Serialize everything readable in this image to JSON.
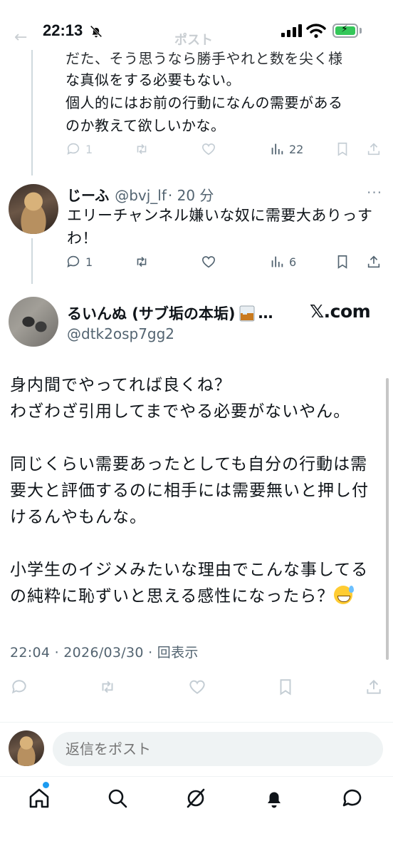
{
  "status_bar": {
    "time": "22:13"
  },
  "header": {
    "title": "ポスト"
  },
  "parent_tweet": {
    "lines": [
      "だた、そう思うなら勝手やれと数を尖く様",
      "な真似をする必要もない。",
      "個人的にはお前の行動になんの需要がある",
      "のか教えて欲しいかな。"
    ],
    "replies": "1",
    "views": "22"
  },
  "reply_tweet": {
    "name": "じーふ",
    "handle": "@bvj_lf",
    "time": "· 20 分",
    "text": "エリーチャンネル嫌いな奴に需要大ありっすわ！",
    "replies": "1",
    "views": "6"
  },
  "main_tweet": {
    "name": "るいんぬ (サブ垢の本垢)",
    "ellipsis": "…",
    "handle": "@dtk2osp7gg2",
    "watermark": "𝕏.com",
    "paragraphs": [
      "身内間でやってれば良くね？",
      "わざわざ引用してまでやる必要がないやん。",
      "",
      "同じくらい需要あったとしても自分の行動は需",
      "要大と評価するのに相手には需要無いと押し付",
      "けるんやもんな。",
      "",
      "小学生のイジメみたいな理由でこんな事してる",
      "の純粋に恥ずいと思える感性になったら？"
    ],
    "meta": "22:04 · 2026/03/30 · 回表示"
  },
  "reply_box": {
    "placeholder": "返信をポスト"
  },
  "tab_bar": {
    "items": [
      "home-icon",
      "search-icon",
      "grok-icon",
      "bell-icon",
      "messages-icon"
    ]
  },
  "colors": {
    "text": "#0f1419",
    "secondary": "#536471",
    "accent": "#1d9bf0",
    "divider": "#eff3f4"
  }
}
